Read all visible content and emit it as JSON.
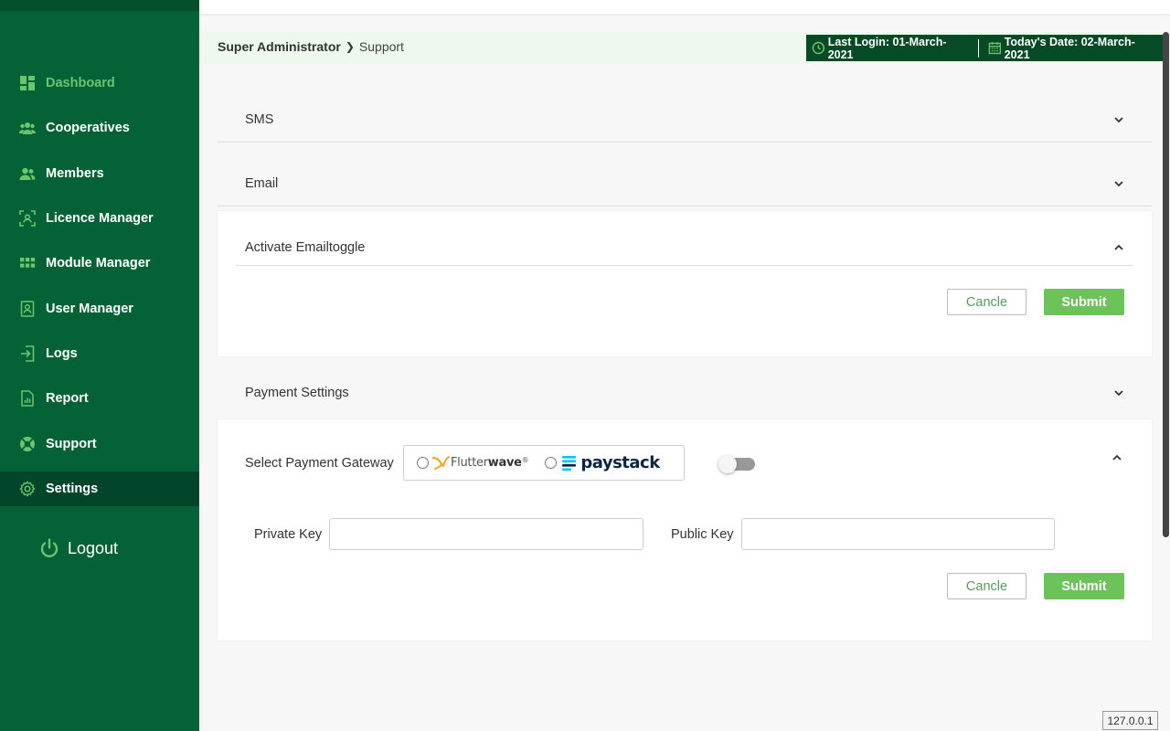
{
  "sidebar": {
    "items": [
      {
        "label": "Dashboard",
        "icon": "dashboard-icon"
      },
      {
        "label": "Cooperatives",
        "icon": "group-icon"
      },
      {
        "label": "Members",
        "icon": "members-icon"
      },
      {
        "label": "Licence Manager",
        "icon": "licence-icon"
      },
      {
        "label": "Module Manager",
        "icon": "grid-icon"
      },
      {
        "label": "User Manager",
        "icon": "user-card-icon"
      },
      {
        "label": "Logs",
        "icon": "login-icon"
      },
      {
        "label": "Report",
        "icon": "report-icon"
      },
      {
        "label": "Support",
        "icon": "lifebuoy-icon"
      },
      {
        "label": "Settings",
        "icon": "gear-icon"
      }
    ],
    "logout_label": "Logout"
  },
  "breadcrumb": {
    "root": "Super Administrator",
    "current": "Support"
  },
  "dates": {
    "last_login": "Last Login: 01-March-2021",
    "today": "Today's Date: 02-March-2021"
  },
  "panels": {
    "sms": "SMS",
    "email": "Email",
    "activate_email": "Activate Emailtoggle",
    "payment_settings": "Payment Settings"
  },
  "email_card": {
    "cancel_label": "Cancle",
    "submit_label": "Submit"
  },
  "payment_card": {
    "gateway_label": "Select Payment Gateway",
    "flutterwave_prefix": "Flutter",
    "flutterwave_suffix": "wave",
    "flutterwave_mark": "®",
    "paystack_label": "paystack",
    "private_key_label": "Private Key",
    "private_key_value": "",
    "public_key_label": "Public Key",
    "public_key_value": "",
    "cancel_label": "Cancle",
    "submit_label": "Submit",
    "toggle_on": false
  },
  "status": {
    "ip": "127.0.0.1"
  },
  "colors": {
    "sidebar_bg": "#046236",
    "accent_green": "#6cc35a",
    "active_text": "#6cc46c",
    "date_box_bg": "#064a26"
  }
}
